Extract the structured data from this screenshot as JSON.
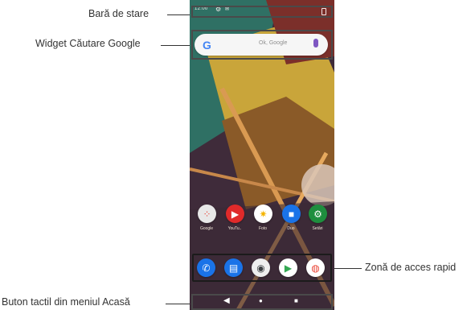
{
  "labels": {
    "status_bar": "Bară de stare",
    "google_widget": "Widget Căutare Google",
    "quick_access": "Zonă de acces rapid",
    "home_touch": "Buton tactil din meniul Acasă"
  },
  "status": {
    "time": "12:00"
  },
  "search": {
    "logo": "G",
    "hint": "Ok, Google"
  },
  "apps": [
    {
      "name": "Google",
      "icon": "google-folder-icon",
      "color": "#e94235"
    },
    {
      "name": "YouTu..",
      "icon": "youtube-icon",
      "color": "#e02a2a"
    },
    {
      "name": "Foto",
      "icon": "photos-icon",
      "color": "#f4b400"
    },
    {
      "name": "Duo",
      "icon": "duo-icon",
      "color": "#1a73e8"
    },
    {
      "name": "Setări",
      "icon": "settings-icon",
      "color": "#1e8e3e"
    }
  ],
  "dock": [
    {
      "icon": "phone-icon",
      "color": "#1a73e8"
    },
    {
      "icon": "messages-icon",
      "color": "#1a73e8"
    },
    {
      "icon": "camera-icon",
      "color": "#5f6368"
    },
    {
      "icon": "play-store-icon",
      "color": "#ffffff"
    },
    {
      "icon": "chrome-icon",
      "color": "#ea4335"
    }
  ],
  "nav": {
    "back": "◀",
    "home": "●",
    "recent": "■"
  }
}
